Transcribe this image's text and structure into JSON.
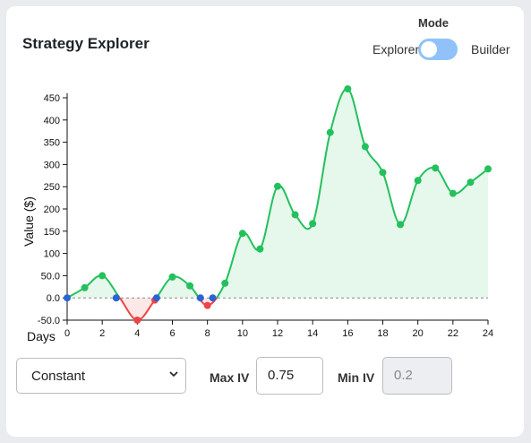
{
  "header": {
    "title": "Strategy Explorer",
    "mode_label": "Mode",
    "mode_left": "Explorer",
    "mode_right": "Builder",
    "mode_selected": "Explorer"
  },
  "chart_data": {
    "type": "area",
    "ylabel": "Value ($)",
    "xlabel": "Days",
    "xlim": [
      0,
      24
    ],
    "ylim": [
      -50,
      450
    ],
    "x_ticks": [
      0,
      2,
      4,
      6,
      8,
      10,
      12,
      14,
      16,
      18,
      20,
      22,
      24
    ],
    "y_ticks": [
      -50,
      0,
      50,
      100,
      150,
      200,
      250,
      300,
      350,
      400,
      450
    ],
    "y_tick_labels": [
      "-50.0",
      "0.0",
      "50.0",
      "100",
      "150",
      "200",
      "250",
      "300",
      "350",
      "400",
      "450"
    ],
    "zero_line": "dashed",
    "series": [
      {
        "x": [
          0,
          1,
          2,
          3,
          4,
          5,
          6,
          7,
          8,
          9,
          10,
          11,
          12,
          13,
          14,
          15,
          16,
          17,
          18,
          19,
          20,
          21,
          22,
          23,
          24
        ],
        "y": [
          0,
          23,
          50,
          0,
          -50,
          -5,
          47,
          27,
          -17,
          33,
          145,
          110,
          251,
          187,
          167,
          372,
          470,
          340,
          282,
          165,
          264,
          292,
          235,
          260,
          290
        ]
      }
    ],
    "breakeven_points": [
      {
        "x": 0,
        "y": 0
      },
      {
        "x": 2.8,
        "y": 0
      },
      {
        "x": 5.1,
        "y": 0
      },
      {
        "x": 7.6,
        "y": 0
      },
      {
        "x": 8.3,
        "y": 0
      }
    ],
    "colors": {
      "positive": "#23c15c",
      "positive_fill": "#e6f7ec",
      "negative": "#ef4444",
      "negative_fill": "#fde8e8",
      "breakeven": "#2a63d4"
    }
  },
  "controls": {
    "iv_mode": "Constant",
    "max_iv_label": "Max IV",
    "max_iv_value": "0.75",
    "min_iv_label": "Min IV",
    "min_iv_value": "0.2"
  }
}
